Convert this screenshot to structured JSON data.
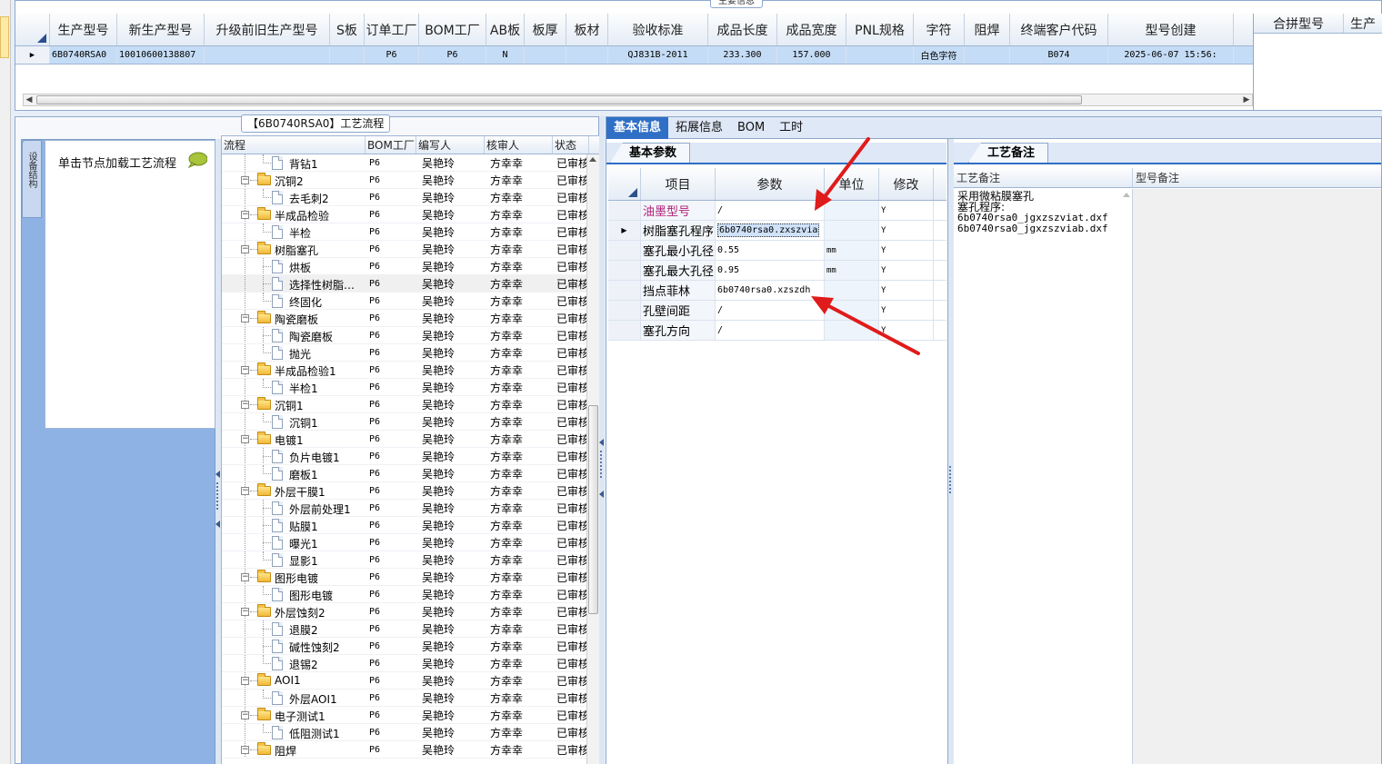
{
  "top": {
    "legend": "主要信息",
    "columns": [
      "生产型号",
      "新生产型号",
      "升级前旧生产型号",
      "S板",
      "订单工厂",
      "BOM工厂",
      "AB板",
      "板厚",
      "板材",
      "验收标准",
      "成品长度",
      "成品宽度",
      "PNL规格",
      "字符",
      "阻焊",
      "终端客户代码",
      "型号创建"
    ],
    "row": {
      "marker": "▶",
      "cells": [
        "6B0740RSA0",
        "10010600138807",
        "",
        "",
        "P6",
        "P6",
        "N",
        "",
        "",
        "QJ831B-2011",
        "233.300",
        "157.000",
        "",
        "白色字符",
        "",
        "B074",
        "2025-06-07 15:56:"
      ]
    },
    "merge_columns": [
      "合拼型号",
      "生产"
    ],
    "hscroll_left": "◀",
    "hscroll_right": "▶"
  },
  "flow": {
    "legend": "【6B0740RSA0】工艺流程",
    "nav_tab_label": "设备结构",
    "nav_hint": "单击节点加载工艺流程",
    "columns": [
      "流程",
      "BOM工厂",
      "编写人",
      "核审人",
      "状态"
    ],
    "rows": [
      {
        "name": "背钻1",
        "level": 2,
        "bom": "P6",
        "writer": "吴艳玲",
        "reviewer": "方幸幸",
        "status": "已审核"
      },
      {
        "name": "沉铜2",
        "level": 1,
        "bom": "P6",
        "writer": "吴艳玲",
        "reviewer": "方幸幸",
        "status": "已审核"
      },
      {
        "name": "去毛刺2",
        "level": 2,
        "bom": "P6",
        "writer": "吴艳玲",
        "reviewer": "方幸幸",
        "status": "已审核"
      },
      {
        "name": "半成品检验",
        "level": 1,
        "bom": "P6",
        "writer": "吴艳玲",
        "reviewer": "方幸幸",
        "status": "已审核"
      },
      {
        "name": "半检",
        "level": 2,
        "bom": "P6",
        "writer": "吴艳玲",
        "reviewer": "方幸幸",
        "status": "已审核"
      },
      {
        "name": "树脂塞孔",
        "level": 1,
        "bom": "P6",
        "writer": "吴艳玲",
        "reviewer": "方幸幸",
        "status": "已审核"
      },
      {
        "name": "烘板",
        "level": 2,
        "bom": "P6",
        "writer": "吴艳玲",
        "reviewer": "方幸幸",
        "status": "已审核"
      },
      {
        "name": "选择性树脂…",
        "level": 2,
        "bom": "P6",
        "writer": "吴艳玲",
        "reviewer": "方幸幸",
        "status": "已审核",
        "selected": true
      },
      {
        "name": "终固化",
        "level": 2,
        "bom": "P6",
        "writer": "吴艳玲",
        "reviewer": "方幸幸",
        "status": "已审核"
      },
      {
        "name": "陶瓷磨板",
        "level": 1,
        "bom": "P6",
        "writer": "吴艳玲",
        "reviewer": "方幸幸",
        "status": "已审核"
      },
      {
        "name": "陶瓷磨板",
        "level": 2,
        "bom": "P6",
        "writer": "吴艳玲",
        "reviewer": "方幸幸",
        "status": "已审核"
      },
      {
        "name": "抛光",
        "level": 2,
        "bom": "P6",
        "writer": "吴艳玲",
        "reviewer": "方幸幸",
        "status": "已审核"
      },
      {
        "name": "半成品检验1",
        "level": 1,
        "bom": "P6",
        "writer": "吴艳玲",
        "reviewer": "方幸幸",
        "status": "已审核"
      },
      {
        "name": "半检1",
        "level": 2,
        "bom": "P6",
        "writer": "吴艳玲",
        "reviewer": "方幸幸",
        "status": "已审核"
      },
      {
        "name": "沉铜1",
        "level": 1,
        "bom": "P6",
        "writer": "吴艳玲",
        "reviewer": "方幸幸",
        "status": "已审核"
      },
      {
        "name": "沉铜1",
        "level": 2,
        "bom": "P6",
        "writer": "吴艳玲",
        "reviewer": "方幸幸",
        "status": "已审核"
      },
      {
        "name": "电镀1",
        "level": 1,
        "bom": "P6",
        "writer": "吴艳玲",
        "reviewer": "方幸幸",
        "status": "已审核"
      },
      {
        "name": "负片电镀1",
        "level": 2,
        "bom": "P6",
        "writer": "吴艳玲",
        "reviewer": "方幸幸",
        "status": "已审核"
      },
      {
        "name": "磨板1",
        "level": 2,
        "bom": "P6",
        "writer": "吴艳玲",
        "reviewer": "方幸幸",
        "status": "已审核"
      },
      {
        "name": "外层干膜1",
        "level": 1,
        "bom": "P6",
        "writer": "吴艳玲",
        "reviewer": "方幸幸",
        "status": "已审核"
      },
      {
        "name": "外层前处理1",
        "level": 2,
        "bom": "P6",
        "writer": "吴艳玲",
        "reviewer": "方幸幸",
        "status": "已审核"
      },
      {
        "name": "贴膜1",
        "level": 2,
        "bom": "P6",
        "writer": "吴艳玲",
        "reviewer": "方幸幸",
        "status": "已审核"
      },
      {
        "name": "曝光1",
        "level": 2,
        "bom": "P6",
        "writer": "吴艳玲",
        "reviewer": "方幸幸",
        "status": "已审核"
      },
      {
        "name": "显影1",
        "level": 2,
        "bom": "P6",
        "writer": "吴艳玲",
        "reviewer": "方幸幸",
        "status": "已审核"
      },
      {
        "name": "图形电镀",
        "level": 1,
        "bom": "P6",
        "writer": "吴艳玲",
        "reviewer": "方幸幸",
        "status": "已审核"
      },
      {
        "name": "图形电镀",
        "level": 2,
        "bom": "P6",
        "writer": "吴艳玲",
        "reviewer": "方幸幸",
        "status": "已审核"
      },
      {
        "name": "外层蚀刻2",
        "level": 1,
        "bom": "P6",
        "writer": "吴艳玲",
        "reviewer": "方幸幸",
        "status": "已审核"
      },
      {
        "name": "退膜2",
        "level": 2,
        "bom": "P6",
        "writer": "吴艳玲",
        "reviewer": "方幸幸",
        "status": "已审核"
      },
      {
        "name": "碱性蚀刻2",
        "level": 2,
        "bom": "P6",
        "writer": "吴艳玲",
        "reviewer": "方幸幸",
        "status": "已审核"
      },
      {
        "name": "退锡2",
        "level": 2,
        "bom": "P6",
        "writer": "吴艳玲",
        "reviewer": "方幸幸",
        "status": "已审核"
      },
      {
        "name": "AOI1",
        "level": 1,
        "bom": "P6",
        "writer": "吴艳玲",
        "reviewer": "方幸幸",
        "status": "已审核"
      },
      {
        "name": "外层AOI1",
        "level": 2,
        "bom": "P6",
        "writer": "吴艳玲",
        "reviewer": "方幸幸",
        "status": "已审核"
      },
      {
        "name": "电子测试1",
        "level": 1,
        "bom": "P6",
        "writer": "吴艳玲",
        "reviewer": "方幸幸",
        "status": "已审核"
      },
      {
        "name": "低阻测试1",
        "level": 2,
        "bom": "P6",
        "writer": "吴艳玲",
        "reviewer": "方幸幸",
        "status": "已审核"
      },
      {
        "name": "阻焊",
        "level": 1,
        "bom": "P6",
        "writer": "吴艳玲",
        "reviewer": "方幸幸",
        "status": "已审核"
      }
    ]
  },
  "detail": {
    "tabs": [
      "基本信息",
      "拓展信息",
      "BOM",
      "工时"
    ],
    "basic_section": "基本参数",
    "param_columns": [
      "项目",
      "参数",
      "单位",
      "修改"
    ],
    "params": [
      {
        "item": "油墨型号",
        "value": "/",
        "unit": "",
        "mod": "Y",
        "highlight": true
      },
      {
        "item": "树脂塞孔程序",
        "value": "6b0740rsa0.zxszvia",
        "unit": "",
        "mod": "Y",
        "current": true
      },
      {
        "item": "塞孔最小孔径",
        "value": "0.55",
        "unit": "mm",
        "mod": "Y"
      },
      {
        "item": "塞孔最大孔径",
        "value": "0.95",
        "unit": "mm",
        "mod": "Y"
      },
      {
        "item": "挡点菲林",
        "value": "6b0740rsa0.xzszdh",
        "unit": "",
        "mod": "Y"
      },
      {
        "item": "孔壁间距",
        "value": "/",
        "unit": "",
        "mod": "Y"
      },
      {
        "item": "塞孔方向",
        "value": "/",
        "unit": "",
        "mod": "Y"
      }
    ],
    "notes_section": "工艺备注",
    "notes_columns": [
      "工艺备注",
      "型号备注"
    ],
    "process_note_lines": [
      "采用微粘膜塞孔",
      "塞孔程序:",
      "6b0740rsa0_jgxzszviat.dxf",
      "6b0740rsa0_jgxzszviab.dxf"
    ],
    "model_note": ""
  },
  "colors": {
    "accent": "#2f6fc6",
    "grid_selected_row": "#c5dcf6",
    "annotation_arrow": "#e01b1b",
    "highlight_item_text": "#b0227a"
  },
  "icons": [
    "chat-bubble-icon",
    "folder-icon",
    "document-icon",
    "row-pointer-icon"
  ]
}
